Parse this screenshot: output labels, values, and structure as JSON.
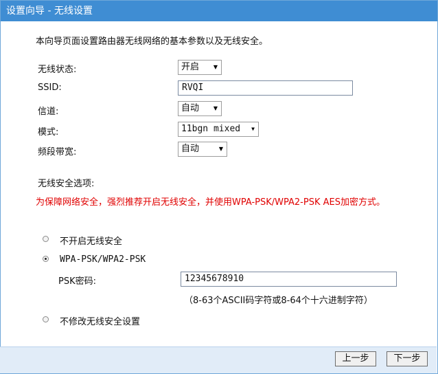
{
  "window": {
    "title": "设置向导 - 无线设置"
  },
  "intro": "本向导页面设置路由器无线网络的基本参数以及无线安全。",
  "fields": {
    "wireless_state": {
      "label": "无线状态:",
      "value": "开启"
    },
    "ssid": {
      "label": "SSID:",
      "value": "RVQI"
    },
    "channel": {
      "label": "信道:",
      "value": "自动"
    },
    "mode": {
      "label": "模式:",
      "value": "11bgn mixed"
    },
    "bandwidth": {
      "label": "频段带宽:",
      "value": "自动"
    }
  },
  "security": {
    "heading": "无线安全选项:",
    "warning": "为保障网络安全，强烈推荐开启无线安全，并使用WPA-PSK/WPA2-PSK AES加密方式。",
    "options": [
      {
        "label": "不开启无线安全",
        "selected": false
      },
      {
        "label": "WPA-PSK/WPA2-PSK",
        "selected": true
      },
      {
        "label": "不修改无线安全设置",
        "selected": false
      }
    ],
    "psk_label": "PSK密码:",
    "psk_value": "12345678910",
    "psk_hint": "（8-63个ASCII码字符或8-64个十六进制字符）"
  },
  "buttons": {
    "prev": "上一步",
    "next": "下一步"
  },
  "icons": {
    "dropdown": "chevron-down-icon"
  }
}
